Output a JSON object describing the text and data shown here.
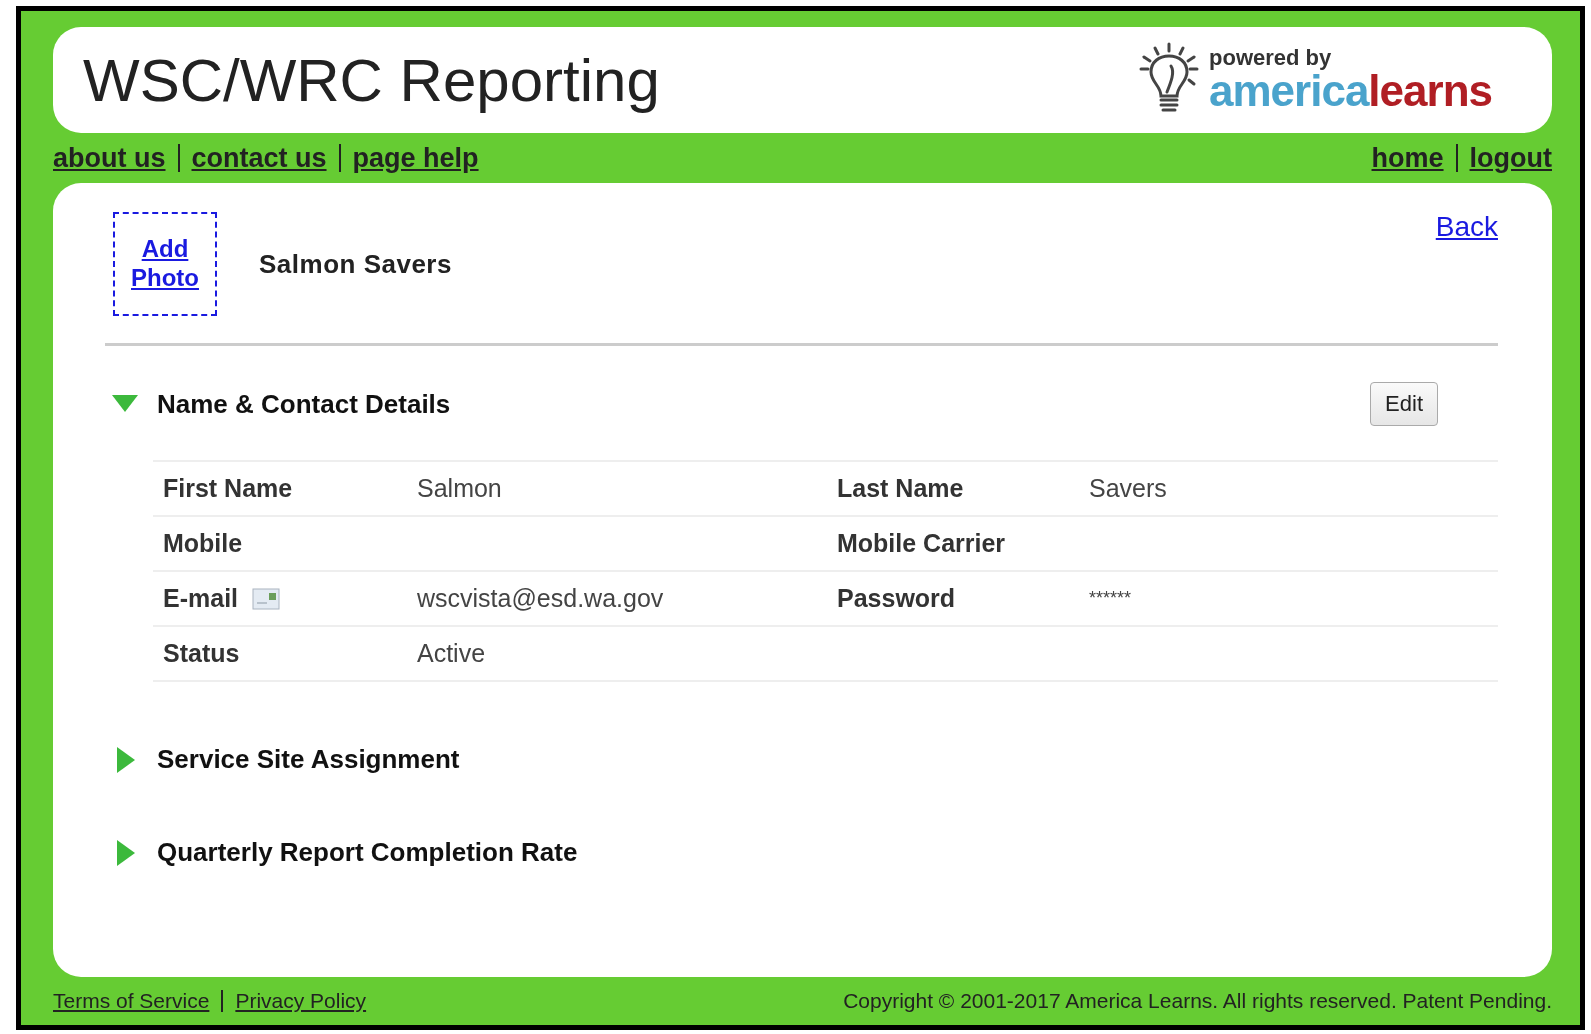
{
  "header": {
    "title": "WSC/WRC Reporting",
    "logo": {
      "tagline": "powered by",
      "brand_first": "america",
      "brand_second": "learns"
    }
  },
  "nav_left": [
    "about us",
    "contact us",
    "page help"
  ],
  "nav_right": [
    "home",
    "logout"
  ],
  "profile": {
    "add_photo": "Add Photo",
    "name": "Salmon Savers",
    "back": "Back"
  },
  "sections": [
    {
      "title": "Name & Contact Details",
      "expanded": true,
      "edit_button": "Edit",
      "rows": [
        [
          {
            "label": "First Name",
            "value": "Salmon",
            "kind": "text"
          },
          {
            "label": "Last Name",
            "value": "Savers",
            "kind": "text"
          }
        ],
        [
          {
            "label": "Mobile",
            "kind": "text"
          },
          {
            "label": "Mobile Carrier",
            "kind": "text"
          }
        ],
        [
          {
            "label": "E-mail",
            "value": "wscvista@esd.wa.gov",
            "kind": "email"
          },
          {
            "label": "Password",
            "value": "******",
            "kind": "masked"
          }
        ],
        [
          {
            "label": "Status",
            "value": "Active",
            "kind": "text"
          }
        ]
      ]
    },
    {
      "title": "Service Site Assignment",
      "expanded": false
    },
    {
      "title": "Quarterly Report Completion Rate",
      "expanded": false
    }
  ],
  "footer": {
    "links": [
      "Terms of Service",
      "Privacy Policy"
    ],
    "copyright": "Copyright © 2001-2017 America Learns. All rights reserved. Patent Pending."
  }
}
